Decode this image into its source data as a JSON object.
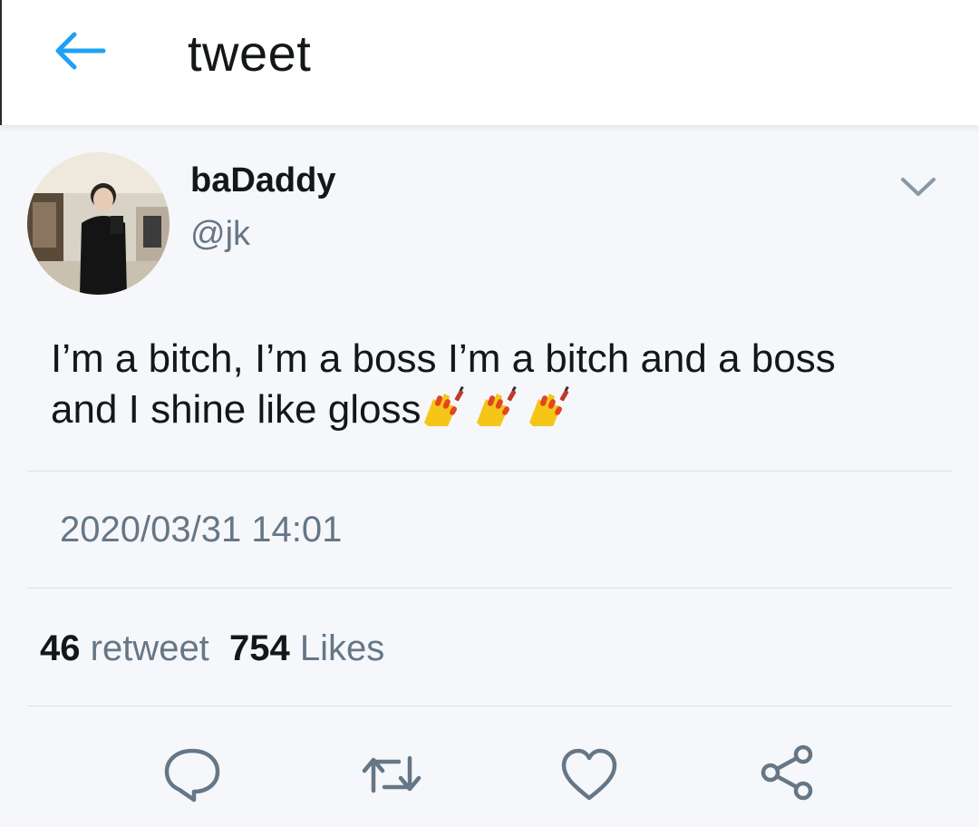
{
  "header": {
    "title": "tweet",
    "back_icon": "arrow-left-icon",
    "accent_color": "#1da1f2"
  },
  "author": {
    "display_name": "baDaddy",
    "handle": "@jk"
  },
  "tweet": {
    "text_line1": "I’m a bitch, I’m a boss I’m a bitch and a boss",
    "text_line2": "and I shine like gloss",
    "emoji": [
      "nail-polish-emoji",
      "nail-polish-emoji",
      "nail-polish-emoji"
    ],
    "timestamp": "2020/03/31 14:01"
  },
  "stats": {
    "retweet_count": "46",
    "retweet_label": "retweet",
    "likes_count": "754",
    "likes_label": "Likes"
  },
  "actions": [
    "reply-icon",
    "retweet-icon",
    "like-icon",
    "share-icon"
  ],
  "colors": {
    "text_primary": "#14171a",
    "text_secondary": "#657786",
    "icon_gray": "#657786",
    "background": "#f6f7fa"
  }
}
